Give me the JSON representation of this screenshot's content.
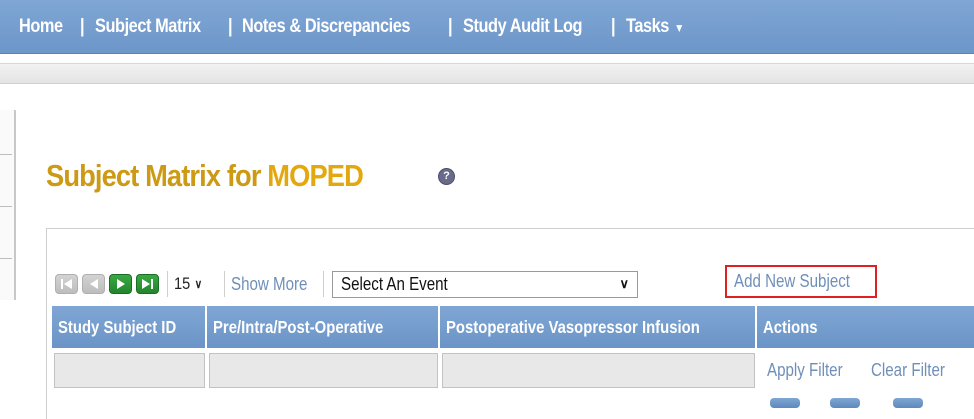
{
  "nav": {
    "items": [
      "Home",
      "Subject Matrix",
      "Notes & Discrepancies",
      "Study Audit Log",
      "Tasks"
    ],
    "separator": "|",
    "tasks_caret": "▼"
  },
  "page": {
    "title_prefix": "Subject Matrix for",
    "study_name": "MOPED",
    "help_icon": "?"
  },
  "toolbar": {
    "page_size": "15",
    "show_more": "Show More",
    "event_select": "Select An Event",
    "add_new_subject": "Add New Subject",
    "pager_buttons": [
      "first",
      "prev",
      "next",
      "last"
    ]
  },
  "table": {
    "columns": [
      "Study Subject ID",
      "Pre/Intra/Post-Operative",
      "Postoperative Vasopressor Infusion",
      "Actions"
    ],
    "apply_filter": "Apply Filter",
    "clear_filter": "Clear Filter"
  },
  "colors": {
    "nav_bg": "#7fa6d4",
    "title": "#cc9a14",
    "link": "#6f8fb8",
    "highlight_border": "#e02020"
  }
}
